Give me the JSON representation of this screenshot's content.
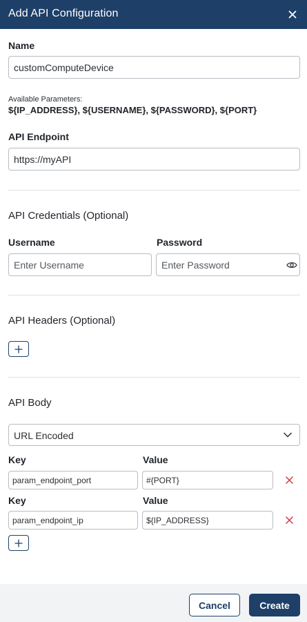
{
  "dialog": {
    "title": "Add API Configuration"
  },
  "name": {
    "label": "Name",
    "value": "customComputeDevice"
  },
  "params": {
    "caption": "Available Parameters:",
    "list": "${IP_ADDRESS}, ${USERNAME}, ${PASSWORD}, ${PORT}"
  },
  "endpoint": {
    "label": "API Endpoint",
    "value": "https://myAPI"
  },
  "credentials": {
    "title": "API Credentials (Optional)",
    "username_label": "Username",
    "username_placeholder": "Enter Username",
    "password_label": "Password",
    "password_placeholder": "Enter Password"
  },
  "headers": {
    "title": "API Headers (Optional)"
  },
  "body": {
    "title": "API Body",
    "encoding": "URL Encoded",
    "key_label": "Key",
    "value_label": "Value",
    "rows": [
      {
        "key": "param_endpoint_port",
        "value": "#{PORT}"
      },
      {
        "key": "param_endpoint_ip",
        "value": "${IP_ADDRESS}"
      }
    ]
  },
  "footer": {
    "cancel": "Cancel",
    "create": "Create"
  },
  "colors": {
    "header": "#1d3f68",
    "remove": "#d9363e",
    "footer_bg": "#f1f3f5"
  },
  "icons": {
    "close": "close-icon",
    "eye": "eye-icon",
    "plus": "plus-icon",
    "chevron": "chevron-down-icon",
    "remove": "remove-x-icon"
  }
}
